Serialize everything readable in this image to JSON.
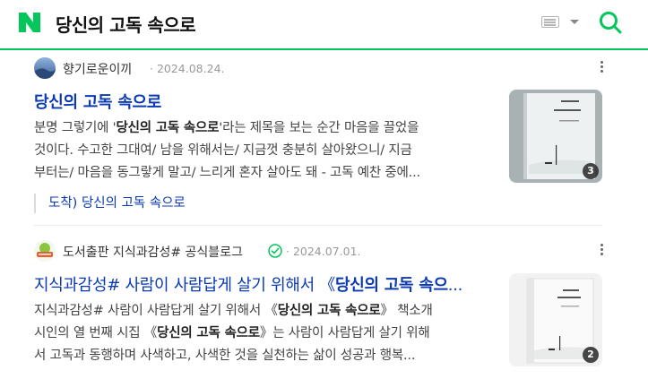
{
  "search": {
    "query": "당신의 고독 속으로"
  },
  "results": [
    {
      "author": "향기로운이끼",
      "date": "· 2024.08.24.",
      "title_bold": "당신의 고독 속으로",
      "desc_lines": [
        [
          "분명 그렇기에 '",
          "당신의 고독 속으로",
          "'라는 제목을 보는 순간 마음을 끌었을"
        ],
        [
          "것이다. 수고한 그대여/ 남을 위해서는/ 지금껏 충분히 살아왔으니/ 지금",
          "",
          ""
        ],
        [
          "부터는/ 마음을 동그랗게 말고/ 느리게 혼자 살아도 돼 - 고독 예찬 중에...",
          "",
          ""
        ]
      ],
      "sub_link": "도착) 당신의 고독 속으로",
      "image_count": "3"
    },
    {
      "author": "도서출판 지식과감성# 공식블로그",
      "date": "· 2024.07.01.",
      "title_prefix": "지식과감성# 사람이 사람답게 살기 위해서 《",
      "title_bold": "당신의 고독 속으",
      "title_suffix": "...",
      "desc_lines": [
        [
          "지식과감성# 사람이 사람답게 살기 위해서 《",
          "당신의 고독 속으로",
          "》 책소개"
        ],
        [
          "시인의 열 번째 시집 《",
          "당신의 고독 속으로",
          "》는 사람이 사람답게 살기 위해"
        ],
        [
          "서 고독과 동행하며 사색하고, 사색한 것을 실천하는 삶이 성공과 행복...",
          "",
          ""
        ]
      ],
      "image_count": "2"
    }
  ],
  "colors": {
    "brand_green": "#03c75a",
    "link_blue": "#0b3ab2"
  }
}
